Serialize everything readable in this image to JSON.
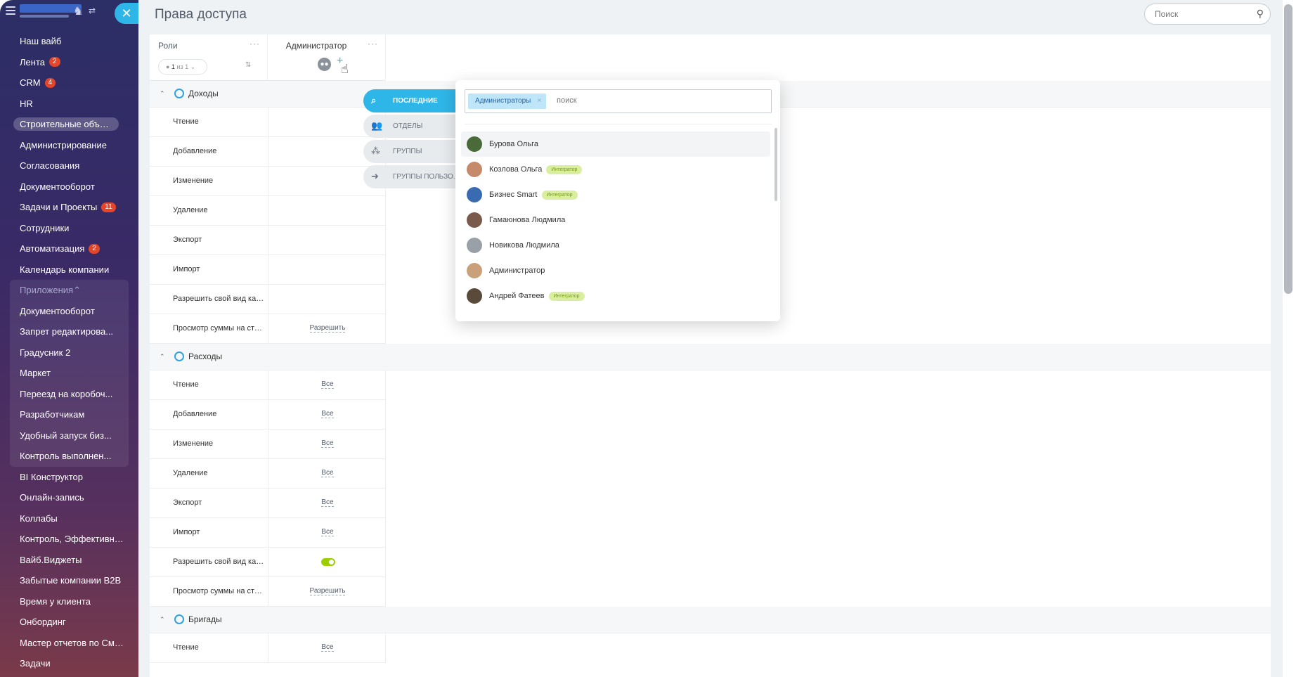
{
  "page": {
    "title": "Права доступа",
    "search_placeholder": "Поиск"
  },
  "sidebar": {
    "items": [
      {
        "label": "Наш вайб"
      },
      {
        "label": "Лента",
        "badge": "2"
      },
      {
        "label": "CRM",
        "badge": "4"
      },
      {
        "label": "HR"
      },
      {
        "label": "Строительные объекты",
        "active": true
      },
      {
        "label": "Администрирование"
      },
      {
        "label": "Согласования"
      },
      {
        "label": "Документооборот"
      },
      {
        "label": "Задачи и Проекты",
        "badge": "11"
      },
      {
        "label": "Сотрудники"
      },
      {
        "label": "Автоматизация",
        "badge": "2"
      },
      {
        "label": "Календарь компании"
      }
    ],
    "apps_group": {
      "label": "Приложения",
      "items": [
        {
          "label": "Документооборот"
        },
        {
          "label": "Запрет редактирова..."
        },
        {
          "label": "Градусник 2"
        },
        {
          "label": "Маркет"
        },
        {
          "label": "Переезд на коробоч..."
        },
        {
          "label": "Разработчикам"
        },
        {
          "label": "Удобный запуск биз..."
        },
        {
          "label": "Контроль выполнен..."
        }
      ]
    },
    "items_bottom": [
      {
        "label": "BI Конструктор"
      },
      {
        "label": "Онлайн-запись"
      },
      {
        "label": "Коллабы"
      },
      {
        "label": "Контроль, Эффективност..."
      },
      {
        "label": "Вайб.Виджеты"
      },
      {
        "label": "Забытые компании B2B"
      },
      {
        "label": "Время у клиента"
      },
      {
        "label": "Онбординг"
      },
      {
        "label": "Мастер отчетов по Смар..."
      },
      {
        "label": "Задачи"
      }
    ]
  },
  "table": {
    "roles_header": "Роли",
    "pager": {
      "current": "1",
      "rest": "из 1"
    },
    "admin_header": "Администратор",
    "sections": [
      {
        "title": "Доходы",
        "rows": [
          {
            "name": "Чтение",
            "value": ""
          },
          {
            "name": "Добавление",
            "value": ""
          },
          {
            "name": "Изменение",
            "value": ""
          },
          {
            "name": "Удаление",
            "value": ""
          },
          {
            "name": "Экспорт",
            "value": ""
          },
          {
            "name": "Импорт",
            "value": ""
          },
          {
            "name": "Разрешить свой вид карт...",
            "value": ""
          },
          {
            "name": "Просмотр суммы на стад...",
            "value": "Разрешить"
          }
        ]
      },
      {
        "title": "Расходы",
        "rows": [
          {
            "name": "Чтение",
            "value": "Все"
          },
          {
            "name": "Добавление",
            "value": "Все"
          },
          {
            "name": "Изменение",
            "value": "Все"
          },
          {
            "name": "Удаление",
            "value": "Все"
          },
          {
            "name": "Экспорт",
            "value": "Все"
          },
          {
            "name": "Импорт",
            "value": "Все"
          },
          {
            "name": "Разрешить свой вид карт...",
            "value": "",
            "toggle": true
          },
          {
            "name": "Просмотр суммы на стад...",
            "value": "Разрешить"
          }
        ]
      },
      {
        "title": "Бригады",
        "rows": [
          {
            "name": "Чтение",
            "value": "Все"
          }
        ]
      }
    ]
  },
  "selector": {
    "tabs": [
      {
        "label": "ПОСЛЕДНИЕ",
        "icon": "clock-search-icon",
        "active": true
      },
      {
        "label": "ОТДЕЛЫ",
        "icon": "departments-icon"
      },
      {
        "label": "ГРУППЫ",
        "icon": "groups-icon"
      },
      {
        "label": "ГРУППЫ ПОЛЬЗО...",
        "icon": "user-groups-icon"
      }
    ],
    "chip": "Администраторы",
    "search_placeholder": "поиск",
    "users": [
      {
        "name": "Бурова Ольга",
        "tag": "",
        "avatar_color": "#4a6a3a"
      },
      {
        "name": "Козлова Ольга",
        "tag": "Интегратор",
        "avatar_color": "#c48a6a"
      },
      {
        "name": "Бизнес Smart",
        "tag": "Интегратор",
        "avatar_color": "#3a6ab0"
      },
      {
        "name": "Гамаюнова Людмила",
        "tag": "",
        "avatar_color": "#7a5a4a"
      },
      {
        "name": "Новикова Людмила",
        "tag": "",
        "avatar_color": "#9aa0a8"
      },
      {
        "name": "Администратор",
        "tag": "",
        "avatar_color": "#c9a07a"
      },
      {
        "name": "Андрей Фатеев",
        "tag": "Интегратор",
        "avatar_color": "#5a4a3a"
      }
    ]
  },
  "colors": {
    "accent": "#2fb6e8",
    "badge": "#e3462a",
    "toggle": "#9dcf00",
    "tag_bg": "#d9ef9f"
  }
}
